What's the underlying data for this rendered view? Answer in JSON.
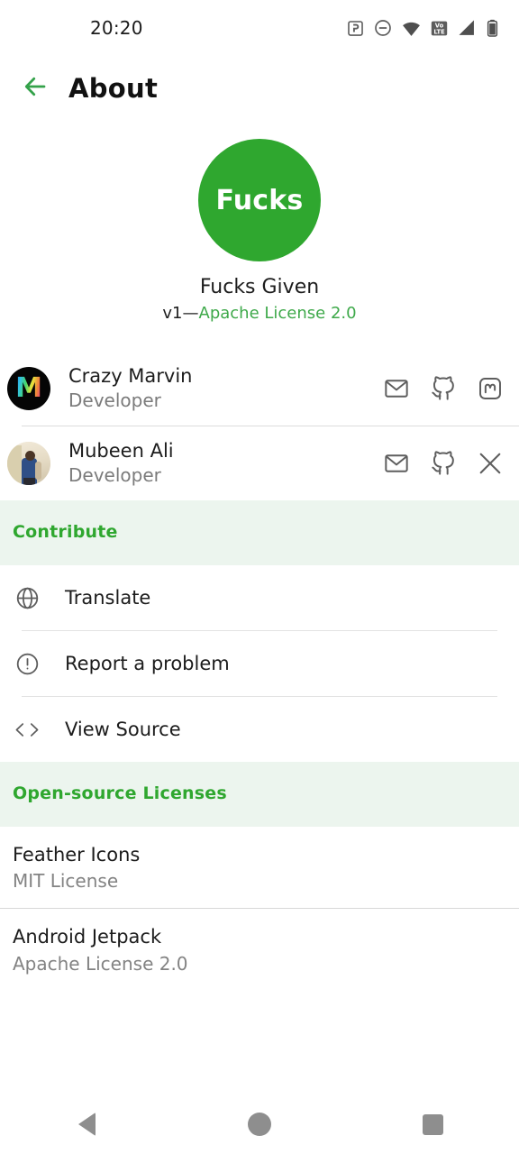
{
  "status_bar": {
    "time": "20:20",
    "icons": [
      "nfc-icon",
      "do-not-disturb-icon",
      "wifi-icon",
      "volte-icon",
      "signal-icon",
      "battery-icon"
    ],
    "volte_label_top": "Vo",
    "volte_label_bottom": "LTE"
  },
  "app_bar": {
    "back_icon": "back-arrow-icon",
    "title": "About"
  },
  "hero": {
    "logo_text": "Fucks",
    "app_name": "Fucks Given",
    "version": "v1",
    "version_separator": "—",
    "license": "Apache License 2.0"
  },
  "developers": [
    {
      "name": "Crazy Marvin",
      "role": "Developer",
      "avatar": "crazy-marvin-avatar",
      "avatar_letter": "M",
      "links": [
        "email-icon",
        "github-icon",
        "mastodon-icon"
      ]
    },
    {
      "name": "Mubeen Ali",
      "role": "Developer",
      "avatar": "mubeen-ali-avatar",
      "links": [
        "email-icon",
        "github-icon",
        "x-twitter-icon"
      ]
    }
  ],
  "contribute": {
    "header": "Contribute",
    "items": [
      {
        "label": "Translate",
        "icon": "globe-icon"
      },
      {
        "label": "Report a problem",
        "icon": "alert-circle-icon"
      },
      {
        "label": "View Source",
        "icon": "code-icon"
      }
    ]
  },
  "licenses": {
    "header": "Open-source Licenses",
    "items": [
      {
        "name": "Feather Icons",
        "license": "MIT License"
      },
      {
        "name": "Android Jetpack",
        "license": "Apache License 2.0"
      }
    ]
  },
  "nav_bar": {
    "back": "nav-back-button",
    "home": "nav-home-button",
    "recents": "nav-recents-button"
  },
  "colors": {
    "accent_green": "#2FA72F",
    "link_green": "#3EA94A",
    "section_bg": "#ECF5EE",
    "text_primary": "#1c1c1c",
    "text_secondary": "#7b7b7b"
  }
}
